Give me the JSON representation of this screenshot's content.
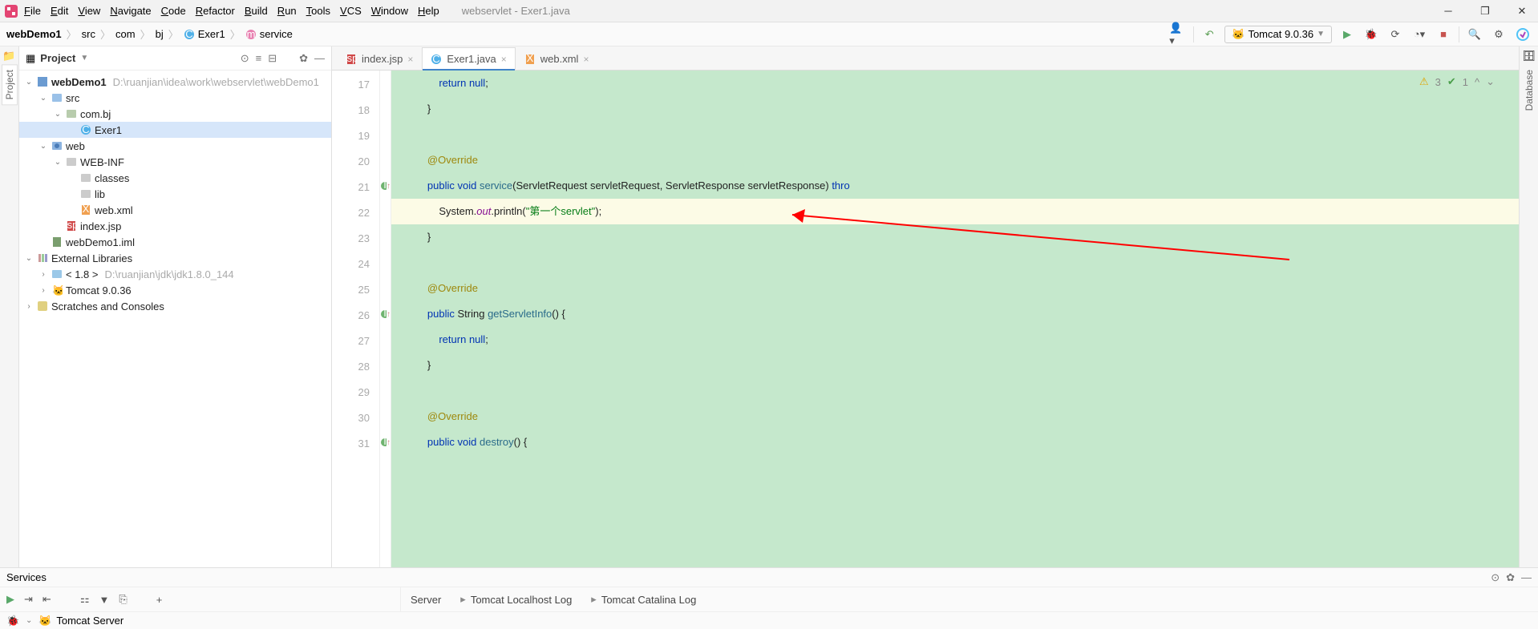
{
  "window_title": "webservlet - Exer1.java",
  "menu": [
    "File",
    "Edit",
    "View",
    "Navigate",
    "Code",
    "Refactor",
    "Build",
    "Run",
    "Tools",
    "VCS",
    "Window",
    "Help"
  ],
  "breadcrumb": [
    {
      "label": "webDemo1",
      "bold": true
    },
    {
      "label": "src"
    },
    {
      "label": "com"
    },
    {
      "label": "bj"
    },
    {
      "label": "Exer1",
      "icon": "class"
    },
    {
      "label": "service",
      "icon": "method"
    }
  ],
  "run_config": "Tomcat 9.0.36",
  "project_title": "Project",
  "tree": [
    {
      "indent": 0,
      "arrow": "v",
      "icon": "module",
      "label": "webDemo1",
      "bold": true,
      "hint": "D:\\ruanjian\\idea\\work\\webservlet\\webDemo1"
    },
    {
      "indent": 1,
      "arrow": "v",
      "icon": "src",
      "label": "src"
    },
    {
      "indent": 2,
      "arrow": "v",
      "icon": "pkg",
      "label": "com.bj"
    },
    {
      "indent": 3,
      "arrow": "",
      "icon": "class",
      "label": "Exer1",
      "sel": true
    },
    {
      "indent": 1,
      "arrow": "v",
      "icon": "webdir",
      "label": "web"
    },
    {
      "indent": 2,
      "arrow": "v",
      "icon": "dir",
      "label": "WEB-INF"
    },
    {
      "indent": 3,
      "arrow": "",
      "icon": "dir",
      "label": "classes"
    },
    {
      "indent": 3,
      "arrow": "",
      "icon": "dir",
      "label": "lib"
    },
    {
      "indent": 3,
      "arrow": "",
      "icon": "xml",
      "label": "web.xml"
    },
    {
      "indent": 2,
      "arrow": "",
      "icon": "jsp",
      "label": "index.jsp"
    },
    {
      "indent": 1,
      "arrow": "",
      "icon": "iml",
      "label": "webDemo1.iml"
    },
    {
      "indent": 0,
      "arrow": "v",
      "icon": "lib",
      "label": "External Libraries"
    },
    {
      "indent": 1,
      "arrow": ">",
      "icon": "jdk",
      "label": "< 1.8 >",
      "hint": "D:\\ruanjian\\jdk\\jdk1.8.0_144"
    },
    {
      "indent": 1,
      "arrow": ">",
      "icon": "tomcat",
      "label": "Tomcat 9.0.36"
    },
    {
      "indent": 0,
      "arrow": ">",
      "icon": "scratch",
      "label": "Scratches and Consoles"
    }
  ],
  "tabs": [
    {
      "label": "index.jsp",
      "icon": "jsp"
    },
    {
      "label": "Exer1.java",
      "icon": "class",
      "active": true
    },
    {
      "label": "web.xml",
      "icon": "xml"
    }
  ],
  "status": {
    "warn": "3",
    "check": "1"
  },
  "code_lines": [
    {
      "n": 17,
      "tokens": [
        [
          "            ",
          ""
        ],
        [
          "return",
          "kw"
        ],
        [
          " ",
          ""
        ],
        [
          "null",
          "kw"
        ],
        [
          ";",
          "txt"
        ]
      ]
    },
    {
      "n": 18,
      "tokens": [
        [
          "        }",
          "txt"
        ]
      ]
    },
    {
      "n": 19,
      "tokens": [
        [
          "",
          ""
        ]
      ]
    },
    {
      "n": 20,
      "tokens": [
        [
          "        ",
          ""
        ],
        [
          "@Override",
          "ann"
        ]
      ]
    },
    {
      "n": 21,
      "mark": "impl",
      "tokens": [
        [
          "        ",
          ""
        ],
        [
          "public",
          "kw"
        ],
        [
          " ",
          ""
        ],
        [
          "void",
          "kw"
        ],
        [
          " ",
          ""
        ],
        [
          "service",
          "mname"
        ],
        [
          "(ServletRequest servletRequest, ServletResponse servletResponse) ",
          "txt"
        ],
        [
          "thro",
          "kw"
        ]
      ]
    },
    {
      "n": 22,
      "hl": true,
      "tokens": [
        [
          "            System.",
          "txt"
        ],
        [
          "out",
          "fld"
        ],
        [
          ".println(",
          "txt"
        ],
        [
          "\"第一个servlet\"",
          "str"
        ],
        [
          ");",
          "txt"
        ]
      ]
    },
    {
      "n": 23,
      "tokens": [
        [
          "        }",
          "txt"
        ]
      ]
    },
    {
      "n": 24,
      "tokens": [
        [
          "",
          ""
        ]
      ]
    },
    {
      "n": 25,
      "tokens": [
        [
          "        ",
          ""
        ],
        [
          "@Override",
          "ann"
        ]
      ]
    },
    {
      "n": 26,
      "mark": "impl",
      "tokens": [
        [
          "        ",
          ""
        ],
        [
          "public",
          "kw"
        ],
        [
          " String ",
          "txt"
        ],
        [
          "getServletInfo",
          "mname"
        ],
        [
          "() {",
          "txt"
        ]
      ]
    },
    {
      "n": 27,
      "tokens": [
        [
          "            ",
          ""
        ],
        [
          "return",
          "kw"
        ],
        [
          " ",
          ""
        ],
        [
          "null",
          "kw"
        ],
        [
          ";",
          "txt"
        ]
      ]
    },
    {
      "n": 28,
      "tokens": [
        [
          "        }",
          "txt"
        ]
      ]
    },
    {
      "n": 29,
      "tokens": [
        [
          "",
          ""
        ]
      ]
    },
    {
      "n": 30,
      "tokens": [
        [
          "        ",
          ""
        ],
        [
          "@Override",
          "ann"
        ]
      ]
    },
    {
      "n": 31,
      "mark": "impl",
      "tokens": [
        [
          "        ",
          ""
        ],
        [
          "public",
          "kw"
        ],
        [
          " ",
          ""
        ],
        [
          "void",
          "kw"
        ],
        [
          " ",
          ""
        ],
        [
          "destroy",
          "mname"
        ],
        [
          "() {",
          "txt"
        ]
      ]
    }
  ],
  "services_title": "Services",
  "server_tabs": [
    "Server",
    "Tomcat Localhost Log",
    "Tomcat Catalina Log"
  ],
  "tomcat_server": "Tomcat Server",
  "rail_left": "Project",
  "rail_right": "Database"
}
